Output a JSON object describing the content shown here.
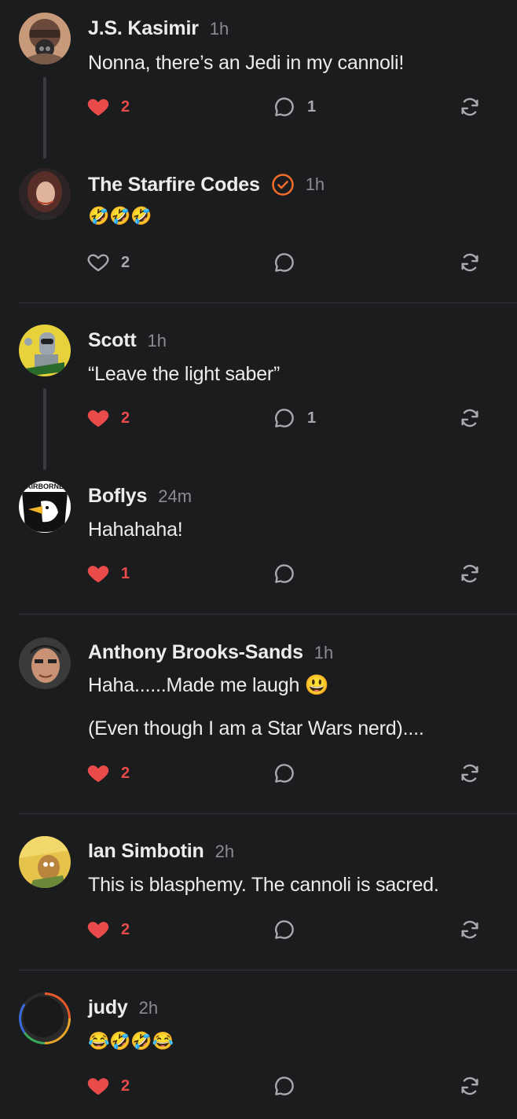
{
  "comments": [
    {
      "author": "J.S. Kasimir",
      "time": "1h",
      "text": "Nonna, there’s an Jedi in my cannoli!",
      "likes": "2",
      "liked": true,
      "replies": "1"
    },
    {
      "author": "The Starfire Codes",
      "time": "1h",
      "text": "🤣🤣🤣",
      "likes": "2",
      "liked": false,
      "replies": "",
      "verified": true
    },
    {
      "author": "Scott",
      "time": "1h",
      "text": "“Leave the light saber”",
      "likes": "2",
      "liked": true,
      "replies": "1"
    },
    {
      "author": "Boflys",
      "time": "24m",
      "text": "Hahahaha!",
      "likes": "1",
      "liked": true,
      "replies": ""
    },
    {
      "author": "Anthony Brooks-Sands",
      "time": "1h",
      "text": "Haha......Made me laugh 😃",
      "text2": "(Even though I am a Star Wars nerd)....",
      "likes": "2",
      "liked": true,
      "replies": ""
    },
    {
      "author": "Ian Simbotin",
      "time": "2h",
      "text": "This is blasphemy.  The cannoli is sacred.",
      "likes": "2",
      "liked": true,
      "replies": ""
    },
    {
      "author": "judy",
      "time": "2h",
      "text": "😂🤣🤣😂",
      "likes": "2",
      "liked": true,
      "replies": ""
    }
  ],
  "avatars": {
    "0": "avatar-masked-figure",
    "1": "avatar-woman-portrait",
    "2": "avatar-robot-cartoon",
    "3": "avatar-airborne-eagle-patch",
    "4": "avatar-man-portrait",
    "5": "avatar-cartoon-dog-book",
    "6": "avatar-dark-circle-rainbow-rim"
  },
  "avatar_texts": {
    "airborne": "AIRBORNE"
  },
  "colors": {
    "accent_red": "#e94b4b",
    "verified_orange": "#f26c2b",
    "background": "#1b1c1e"
  }
}
